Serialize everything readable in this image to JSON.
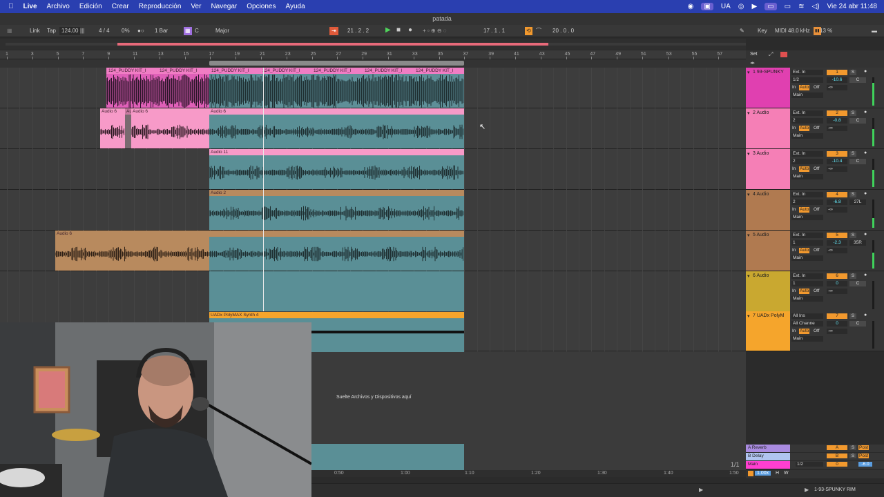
{
  "menubar": {
    "items": [
      "Live",
      "Archivo",
      "Edición",
      "Crear",
      "Reproducción",
      "Ver",
      "Navegar",
      "Opciones",
      "Ayuda"
    ],
    "lang": "UA",
    "clock": "Vie 24 abr  11:48"
  },
  "window_title": "patada",
  "transport": {
    "link": "Link",
    "tap": "Tap",
    "tempo": "124.00",
    "signature": "4 / 4",
    "groove": "0%",
    "quant": "1 Bar",
    "key": "C",
    "scale": "Major",
    "position": "21 .  2 .  2",
    "loop_start": "17 .  1 .  1",
    "loop_length": "20 .  0 .  0",
    "key_label": "Key",
    "midi_label": "MIDI",
    "sample_rate": "48.0 kHz",
    "cpu": "13 %"
  },
  "ruler": {
    "bars": [
      "1",
      "3",
      "5",
      "7",
      "9",
      "11",
      "13",
      "15",
      "17",
      "19",
      "21",
      "23",
      "25",
      "27",
      "29",
      "31",
      "33",
      "35",
      "37",
      "39",
      "41",
      "43",
      "45",
      "47",
      "49",
      "51",
      "53",
      "55",
      "57"
    ],
    "set_label": "Set"
  },
  "tracks": [
    {
      "name": "1 93-SPUNKY",
      "color": "#e040b0",
      "num": "1",
      "input": "Ext. In",
      "channel": "1/2",
      "volume": "-10.6",
      "pan": "C",
      "output": "Main",
      "clips": [
        "124_PUDDY KIT_I",
        "124_PUDDY KIT_I",
        "124_PUDDY KIT_I",
        "124_PUDDY KIT_I",
        "124_PUDDY KIT_I",
        "124_PUDDY KIT_I",
        "124_PUDDY KIT_I"
      ]
    },
    {
      "name": "2 Audio",
      "color": "#f57fb6",
      "num": "2",
      "input": "Ext. In",
      "channel": "2",
      "volume": "-0.8",
      "pan": "C",
      "output": "Main",
      "clips": [
        "Audio 6",
        "Au",
        "Audio 6",
        "Audio 6"
      ]
    },
    {
      "name": "3 Audio",
      "color": "#f57fb6",
      "num": "3",
      "input": "Ext. In",
      "channel": "2",
      "volume": "-10.4",
      "pan": "C",
      "output": "Main",
      "clips": [
        "Audio 11"
      ]
    },
    {
      "name": "4 Audio",
      "color": "#b07a50",
      "num": "4",
      "input": "Ext. In",
      "channel": "2",
      "volume": "-6.8",
      "pan": "27L",
      "output": "Main",
      "clips": [
        "Audio 2"
      ]
    },
    {
      "name": "5 Audio",
      "color": "#b07a50",
      "num": "5",
      "input": "Ext. In",
      "channel": "1",
      "volume": "-2.3",
      "pan": "35R",
      "output": "Main",
      "clips": [
        "Audio 6"
      ]
    },
    {
      "name": "6 Audio",
      "color": "#c9a830",
      "num": "6",
      "input": "Ext. In",
      "channel": "1",
      "volume": "0",
      "pan": "C",
      "output": "Main",
      "clips": []
    },
    {
      "name": "7 UADx PolyM",
      "color": "#f5a52c",
      "num": "7",
      "input": "All Ins",
      "channel": "All Channe",
      "volume": "0",
      "pan": "C",
      "output": "Main",
      "clips": [
        "UADx PolyMAX Synth 4"
      ]
    }
  ],
  "mixer_labels": {
    "solo": "S",
    "in": "In",
    "auto": "Auto",
    "off": "Off",
    "neg_inf": "-∞"
  },
  "returns": [
    {
      "name": "A Reverb",
      "color": "#a98be0",
      "letter": "A",
      "post": "Post"
    },
    {
      "name": "B Delay",
      "color": "#b0c4f0",
      "letter": "B",
      "post": "Post"
    },
    {
      "name": "Main",
      "color": "#ff3fd0",
      "letter": "0",
      "volume": "-6.0",
      "output": "1/2"
    }
  ],
  "drop_hint": "Suelte Archivos y Dispositivos aquí",
  "time_axis": [
    "0:50",
    "1:00",
    "1:10",
    "1:20",
    "1:30",
    "1:40",
    "1:50"
  ],
  "page_indicator": "1/1",
  "zoom": "1.00x",
  "status": {
    "clip_name": "1-93-SPUNKY RIM",
    "h_label": "H",
    "w_label": "W"
  }
}
